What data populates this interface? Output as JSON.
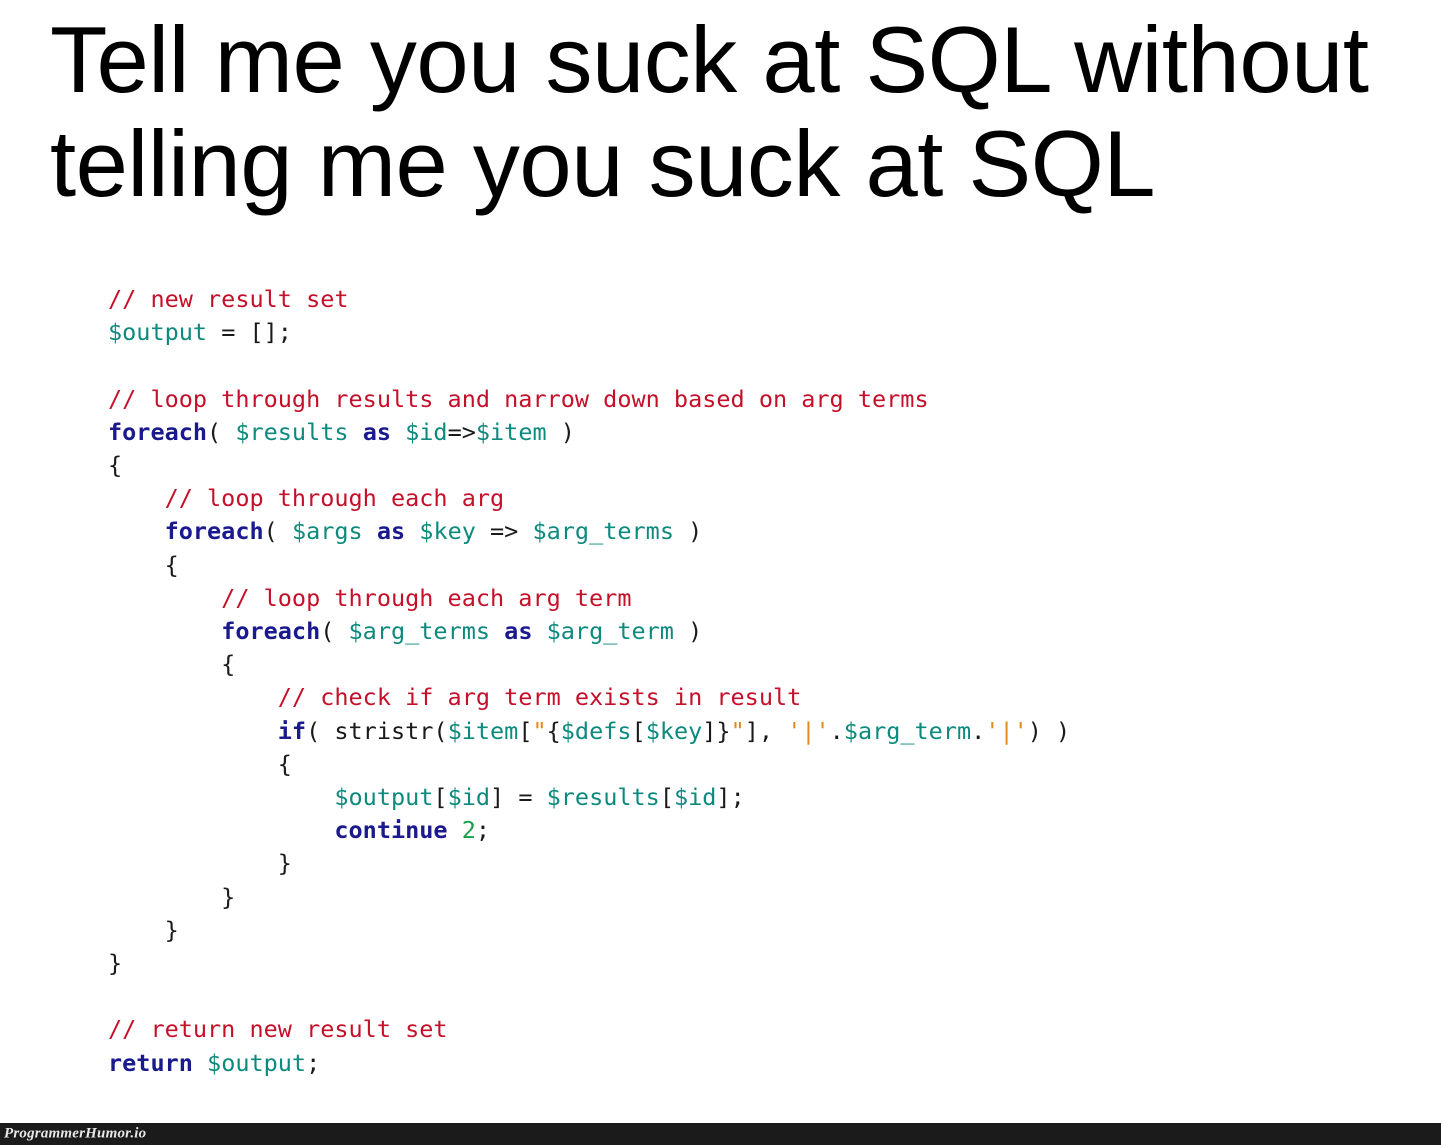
{
  "meme": {
    "title": "Tell me you suck at SQL without telling me you suck at SQL",
    "title_line_1": "Tell me you suck at SQL without",
    "title_line_2": "telling me you suck at SQL",
    "background_color": "#ffffff",
    "title_color": "#000000"
  },
  "watermark": {
    "label": "ProgrammerHumor.io",
    "bar_color": "#1b1b1b",
    "text_color": "#e8e8e8"
  },
  "code": {
    "language": "php",
    "plain_text": "// new result set\n$output = [];\n\n// loop through results and narrow down based on arg terms\nforeach( $results as $id=>$item )\n{\n    // loop through each arg\n    foreach( $args as $key => $arg_terms )\n    {\n        // loop through each arg term\n        foreach( $arg_terms as $arg_term )\n        {\n            // check if arg term exists in result\n            if( stristr($item[\"{$defs[$key]}\"], '|'.$arg_term.'|') )\n            {\n                $output[$id] = $results[$id];\n                continue 2;\n            }\n        }\n    }\n}\n\n// return new result set\nreturn $output;",
    "palette": {
      "comment": "#c5102a",
      "keyword": "#1a1a8e",
      "variable": "#0d8a7e",
      "string": "#e08a1e",
      "number": "#1a9e4b",
      "plain": "#1a1a1a"
    },
    "lines": [
      {
        "n": 1,
        "tokens": [
          {
            "c": "comment",
            "t": "// new result set"
          }
        ]
      },
      {
        "n": 2,
        "tokens": [
          {
            "c": "var",
            "t": "$output"
          },
          {
            "c": "plain",
            "t": " = [];"
          }
        ]
      },
      {
        "n": 3,
        "tokens": [
          {
            "c": "plain",
            "t": ""
          }
        ]
      },
      {
        "n": 4,
        "tokens": [
          {
            "c": "comment",
            "t": "// loop through results and narrow down based on arg terms"
          }
        ]
      },
      {
        "n": 5,
        "tokens": [
          {
            "c": "keyword",
            "t": "foreach"
          },
          {
            "c": "plain",
            "t": "( "
          },
          {
            "c": "var",
            "t": "$results"
          },
          {
            "c": "plain",
            "t": " "
          },
          {
            "c": "keyword",
            "t": "as"
          },
          {
            "c": "plain",
            "t": " "
          },
          {
            "c": "var",
            "t": "$id"
          },
          {
            "c": "plain",
            "t": "=>"
          },
          {
            "c": "var",
            "t": "$item"
          },
          {
            "c": "plain",
            "t": " )"
          }
        ]
      },
      {
        "n": 6,
        "tokens": [
          {
            "c": "plain",
            "t": "{"
          }
        ]
      },
      {
        "n": 7,
        "tokens": [
          {
            "c": "comment",
            "t": "    // loop through each arg"
          }
        ]
      },
      {
        "n": 8,
        "tokens": [
          {
            "c": "plain",
            "t": "    "
          },
          {
            "c": "keyword",
            "t": "foreach"
          },
          {
            "c": "plain",
            "t": "( "
          },
          {
            "c": "var",
            "t": "$args"
          },
          {
            "c": "plain",
            "t": " "
          },
          {
            "c": "keyword",
            "t": "as"
          },
          {
            "c": "plain",
            "t": " "
          },
          {
            "c": "var",
            "t": "$key"
          },
          {
            "c": "plain",
            "t": " => "
          },
          {
            "c": "var",
            "t": "$arg_terms"
          },
          {
            "c": "plain",
            "t": " )"
          }
        ]
      },
      {
        "n": 9,
        "tokens": [
          {
            "c": "plain",
            "t": "    {"
          }
        ]
      },
      {
        "n": 10,
        "tokens": [
          {
            "c": "comment",
            "t": "        // loop through each arg term"
          }
        ]
      },
      {
        "n": 11,
        "tokens": [
          {
            "c": "plain",
            "t": "        "
          },
          {
            "c": "keyword",
            "t": "foreach"
          },
          {
            "c": "plain",
            "t": "( "
          },
          {
            "c": "var",
            "t": "$arg_terms"
          },
          {
            "c": "plain",
            "t": " "
          },
          {
            "c": "keyword",
            "t": "as"
          },
          {
            "c": "plain",
            "t": " "
          },
          {
            "c": "var",
            "t": "$arg_term"
          },
          {
            "c": "plain",
            "t": " )"
          }
        ]
      },
      {
        "n": 12,
        "tokens": [
          {
            "c": "plain",
            "t": "        {"
          }
        ]
      },
      {
        "n": 13,
        "tokens": [
          {
            "c": "comment",
            "t": "            // check if arg term exists in result"
          }
        ]
      },
      {
        "n": 14,
        "tokens": [
          {
            "c": "plain",
            "t": "            "
          },
          {
            "c": "keyword",
            "t": "if"
          },
          {
            "c": "plain",
            "t": "( stristr("
          },
          {
            "c": "var",
            "t": "$item"
          },
          {
            "c": "plain",
            "t": "["
          },
          {
            "c": "string",
            "t": "\""
          },
          {
            "c": "plain",
            "t": "{"
          },
          {
            "c": "var",
            "t": "$defs"
          },
          {
            "c": "plain",
            "t": "["
          },
          {
            "c": "var",
            "t": "$key"
          },
          {
            "c": "plain",
            "t": "]}"
          },
          {
            "c": "string",
            "t": "\""
          },
          {
            "c": "plain",
            "t": "], "
          },
          {
            "c": "string",
            "t": "'|'"
          },
          {
            "c": "plain",
            "t": "."
          },
          {
            "c": "var",
            "t": "$arg_term"
          },
          {
            "c": "plain",
            "t": "."
          },
          {
            "c": "string",
            "t": "'|'"
          },
          {
            "c": "plain",
            "t": ") )"
          }
        ]
      },
      {
        "n": 15,
        "tokens": [
          {
            "c": "plain",
            "t": "            {"
          }
        ]
      },
      {
        "n": 16,
        "tokens": [
          {
            "c": "plain",
            "t": "                "
          },
          {
            "c": "var",
            "t": "$output"
          },
          {
            "c": "plain",
            "t": "["
          },
          {
            "c": "var",
            "t": "$id"
          },
          {
            "c": "plain",
            "t": "] = "
          },
          {
            "c": "var",
            "t": "$results"
          },
          {
            "c": "plain",
            "t": "["
          },
          {
            "c": "var",
            "t": "$id"
          },
          {
            "c": "plain",
            "t": "];"
          }
        ]
      },
      {
        "n": 17,
        "tokens": [
          {
            "c": "plain",
            "t": "                "
          },
          {
            "c": "keyword",
            "t": "continue"
          },
          {
            "c": "plain",
            "t": " "
          },
          {
            "c": "number",
            "t": "2"
          },
          {
            "c": "plain",
            "t": ";"
          }
        ]
      },
      {
        "n": 18,
        "tokens": [
          {
            "c": "plain",
            "t": "            }"
          }
        ]
      },
      {
        "n": 19,
        "tokens": [
          {
            "c": "plain",
            "t": "        }"
          }
        ]
      },
      {
        "n": 20,
        "tokens": [
          {
            "c": "plain",
            "t": "    }"
          }
        ]
      },
      {
        "n": 21,
        "tokens": [
          {
            "c": "plain",
            "t": "}"
          }
        ]
      },
      {
        "n": 22,
        "tokens": [
          {
            "c": "plain",
            "t": ""
          }
        ]
      },
      {
        "n": 23,
        "tokens": [
          {
            "c": "comment",
            "t": "// return new result set"
          }
        ]
      },
      {
        "n": 24,
        "tokens": [
          {
            "c": "keyword",
            "t": "return"
          },
          {
            "c": "plain",
            "t": " "
          },
          {
            "c": "var",
            "t": "$output"
          },
          {
            "c": "plain",
            "t": ";"
          }
        ]
      }
    ]
  }
}
